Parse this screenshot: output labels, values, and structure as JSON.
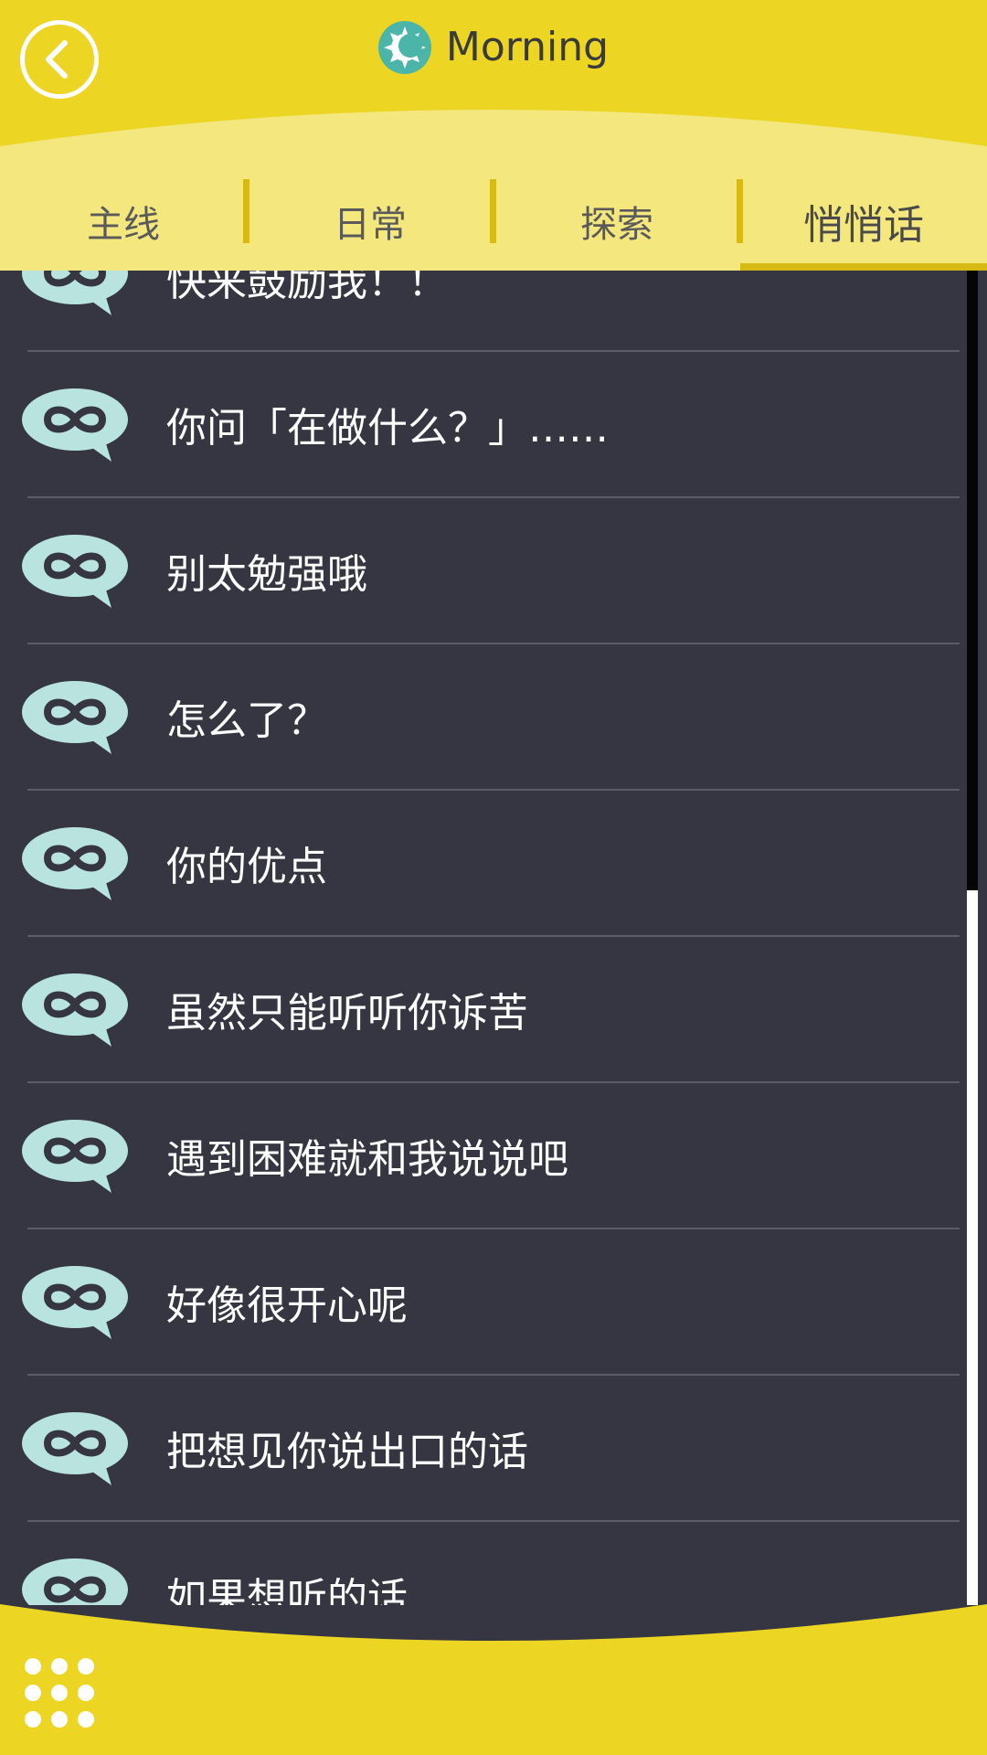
{
  "header": {
    "title": "Morning",
    "back_icon": "back-arrow-icon",
    "title_icon": "sun-moon-icon"
  },
  "tabs": [
    {
      "label": "主线",
      "active": false
    },
    {
      "label": "日常",
      "active": false
    },
    {
      "label": "探索",
      "active": false
    },
    {
      "label": "悄悄话",
      "active": true
    }
  ],
  "list": {
    "item_icon": "chat-bubble-infinity-icon",
    "items": [
      {
        "label": "快来鼓励我！！"
      },
      {
        "label": "你问「在做什么？」……"
      },
      {
        "label": "别太勉强哦"
      },
      {
        "label": "怎么了？"
      },
      {
        "label": "你的优点"
      },
      {
        "label": "虽然只能听听你诉苦"
      },
      {
        "label": "遇到困难就和我说说吧"
      },
      {
        "label": "好像很开心呢"
      },
      {
        "label": "把想见你说出口的话"
      },
      {
        "label": "如果想听的话……"
      }
    ]
  },
  "footer": {
    "menu_icon": "grid-menu-icon"
  },
  "colors": {
    "header_yellow": "#ecd523",
    "tab_bar_yellow": "#f3e77e",
    "accent_gold": "#d7bb14",
    "list_background": "#353642",
    "icon_teal": "#b9e3df",
    "sun_teal": "#4ab5a8"
  }
}
